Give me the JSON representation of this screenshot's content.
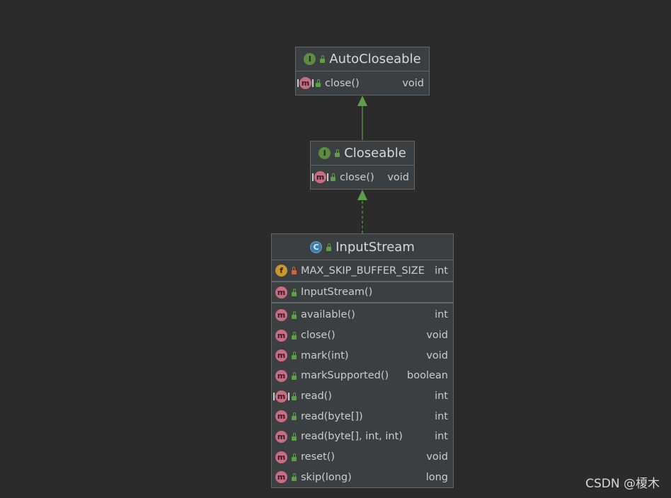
{
  "diagram": {
    "auto_closeable": {
      "name": "AutoCloseable",
      "kind_icon": "interface-icon",
      "methods": [
        {
          "name": "close()",
          "type": "void",
          "icon": "abstract-method-icon"
        }
      ]
    },
    "closeable": {
      "name": "Closeable",
      "kind_icon": "interface-icon",
      "methods": [
        {
          "name": "close()",
          "type": "void",
          "icon": "abstract-method-icon"
        }
      ]
    },
    "input_stream": {
      "name": "InputStream",
      "kind_icon": "abstract-class-icon",
      "fields": [
        {
          "name": "MAX_SKIP_BUFFER_SIZE",
          "type": "int",
          "icon": "final-field-icon",
          "visibility": "private"
        }
      ],
      "constructors": [
        {
          "name": "InputStream()",
          "type": "",
          "icon": "method-icon"
        }
      ],
      "methods": [
        {
          "name": "available()",
          "type": "int",
          "icon": "method-icon"
        },
        {
          "name": "close()",
          "type": "void",
          "icon": "method-icon"
        },
        {
          "name": "mark(int)",
          "type": "void",
          "icon": "method-icon"
        },
        {
          "name": "markSupported()",
          "type": "boolean",
          "icon": "method-icon"
        },
        {
          "name": "read()",
          "type": "int",
          "icon": "abstract-method-icon"
        },
        {
          "name": "read(byte[])",
          "type": "int",
          "icon": "method-icon"
        },
        {
          "name": "read(byte[], int, int)",
          "type": "int",
          "icon": "method-icon"
        },
        {
          "name": "reset()",
          "type": "void",
          "icon": "method-icon"
        },
        {
          "name": "skip(long)",
          "type": "long",
          "icon": "method-icon"
        }
      ]
    },
    "edges": [
      {
        "from": "Closeable",
        "to": "AutoCloseable",
        "kind": "extends",
        "style": "solid"
      },
      {
        "from": "InputStream",
        "to": "Closeable",
        "kind": "implements",
        "style": "dashed"
      }
    ]
  },
  "colors": {
    "background": "#2b2b2b",
    "box": "#3c3f41",
    "border": "#62676b",
    "edge": "#5d9e48",
    "method_badge": "#c76d84",
    "interface_badge": "#5b8c3f",
    "field_badge": "#c9962f",
    "class_badge": "#3d7fa8"
  },
  "watermark": "CSDN @榎木"
}
